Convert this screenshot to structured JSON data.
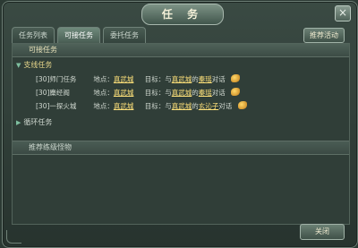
{
  "window": {
    "title": "任 务",
    "close_glyph": "×"
  },
  "tabs": [
    {
      "label": "任务列表"
    },
    {
      "label": "可接任务"
    },
    {
      "label": "委托任务"
    }
  ],
  "toolbar": {
    "recommend_label": "推荐活动"
  },
  "panel": {
    "header": "可接任务",
    "branch_section": "支线任务",
    "loop_section": "循环任务",
    "monster_bar": "推荐练级怪物"
  },
  "tasks": [
    {
      "name": "[30]师门任务",
      "loc_label": "地点：",
      "loc": "真武城",
      "goal_label": "目标：与",
      "goal_place": "真武城",
      "goal_of": "的",
      "goal_npc": "秦瑶",
      "goal_end": "对话"
    },
    {
      "name": "[30]麋经阁",
      "loc_label": "地点：",
      "loc": "真武城",
      "goal_label": "目标：与",
      "goal_place": "真武城",
      "goal_of": "的",
      "goal_npc": "秦瑶",
      "goal_end": "对话"
    },
    {
      "name": "[30]一探火城",
      "loc_label": "地点：",
      "loc": "真武城",
      "goal_label": "目标：与",
      "goal_place": "真武城",
      "goal_of": "的",
      "goal_npc": "玄沁子",
      "goal_end": "对话"
    }
  ],
  "footer": {
    "close_label": "关闭"
  },
  "colors": {
    "link": "#ffe27a",
    "accent": "#7fc0a0"
  }
}
